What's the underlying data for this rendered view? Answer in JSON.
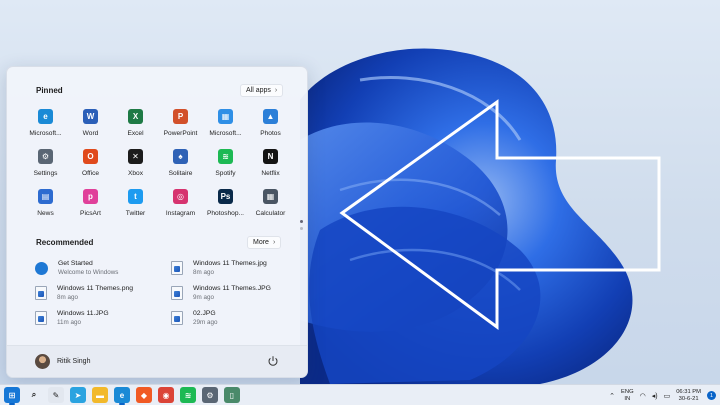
{
  "start_menu": {
    "pinned_title": "Pinned",
    "all_apps_label": "All apps",
    "pinned_apps": [
      {
        "label": "Microsoft...",
        "icon": "edge-icon",
        "color": "#1a8ad6"
      },
      {
        "label": "Word",
        "icon": "word-icon",
        "color": "#2b5fb8"
      },
      {
        "label": "Excel",
        "icon": "excel-icon",
        "color": "#1e7a45"
      },
      {
        "label": "PowerPoint",
        "icon": "powerpoint-icon",
        "color": "#d2502a"
      },
      {
        "label": "Microsoft...",
        "icon": "store-icon",
        "color": "#2f8fe6"
      },
      {
        "label": "Photos",
        "icon": "photos-icon",
        "color": "#2c7fd8"
      },
      {
        "label": "Settings",
        "icon": "settings-icon",
        "color": "#5a6674"
      },
      {
        "label": "Office",
        "icon": "office-icon",
        "color": "#e04a1c"
      },
      {
        "label": "Xbox",
        "icon": "xbox-icon",
        "color": "#1c1c1c"
      },
      {
        "label": "Solitaire",
        "icon": "solitaire-icon",
        "color": "#2f62b6"
      },
      {
        "label": "Spotify",
        "icon": "spotify-icon",
        "color": "#1db954"
      },
      {
        "label": "Netflix",
        "icon": "netflix-icon",
        "color": "#141414"
      },
      {
        "label": "News",
        "icon": "news-icon",
        "color": "#2d6bd0"
      },
      {
        "label": "PicsArt",
        "icon": "picsart-icon",
        "color": "#e0409a"
      },
      {
        "label": "Twitter",
        "icon": "twitter-icon",
        "color": "#1d9bf0"
      },
      {
        "label": "Instagram",
        "icon": "instagram-icon",
        "color": "#d6336f"
      },
      {
        "label": "Photoshop...",
        "icon": "photoshop-icon",
        "color": "#0a2a4a"
      },
      {
        "label": "Calculator",
        "icon": "calculator-icon",
        "color": "#4a5563"
      }
    ],
    "recommended_title": "Recommended",
    "more_label": "More",
    "recommended": [
      {
        "name": "Get Started",
        "detail": "Welcome to Windows",
        "type": "app"
      },
      {
        "name": "Windows 11 Themes.jpg",
        "detail": "8m ago",
        "type": "file"
      },
      {
        "name": "Windows 11 Themes.png",
        "detail": "8m ago",
        "type": "file"
      },
      {
        "name": "Windows 11 Themes.JPG",
        "detail": "9m ago",
        "type": "file"
      },
      {
        "name": "Windows 11.JPG",
        "detail": "11m ago",
        "type": "file"
      },
      {
        "name": "02.JPG",
        "detail": "29m ago",
        "type": "file"
      }
    ],
    "user_name": "Ritik Singh"
  },
  "taskbar": {
    "pinned": [
      {
        "icon": "windows-start-icon",
        "color": "#1677d6",
        "active": true
      },
      {
        "icon": "search-icon",
        "color": "#2b2b2b",
        "active": false
      },
      {
        "icon": "paint-icon",
        "color": "#e2e7ef",
        "active": false
      },
      {
        "icon": "telegram-icon",
        "color": "#2aa3e0",
        "active": false
      },
      {
        "icon": "file-explorer-icon",
        "color": "#f2b92b",
        "active": false
      },
      {
        "icon": "edge-icon",
        "color": "#1a8ad6",
        "active": true
      },
      {
        "icon": "brave-icon",
        "color": "#f15a24",
        "active": false
      },
      {
        "icon": "chrome-icon",
        "color": "#db4437",
        "active": false
      },
      {
        "icon": "spotify-icon",
        "color": "#1db954",
        "active": false
      },
      {
        "icon": "settings-icon",
        "color": "#5a6674",
        "active": false
      },
      {
        "icon": "phone-icon",
        "color": "#4a8a6a",
        "active": false
      }
    ],
    "tray": {
      "lang_line1": "ENG",
      "lang_line2": "IN",
      "time": "06:31 PM",
      "date": "30-6-21",
      "notification_count": "1"
    }
  }
}
